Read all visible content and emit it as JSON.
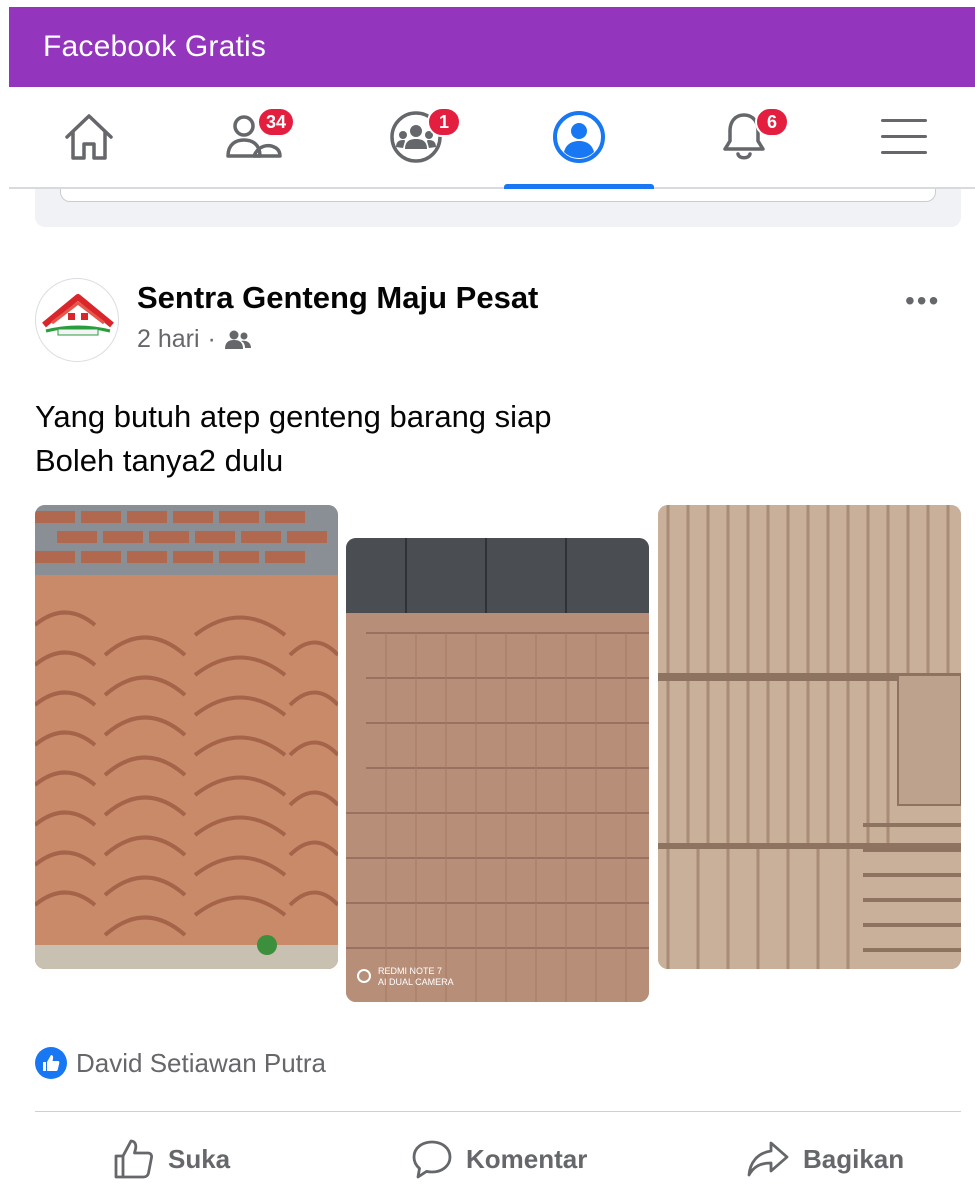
{
  "app_bar": {
    "title": "Facebook Gratis"
  },
  "nav": {
    "items": [
      {
        "name": "home",
        "icon": "home-icon",
        "badge": ""
      },
      {
        "name": "friends",
        "icon": "friends-icon",
        "badge": "34"
      },
      {
        "name": "groups",
        "icon": "groups-icon",
        "badge": "1"
      },
      {
        "name": "profile",
        "icon": "profile-icon",
        "badge": "",
        "active": true
      },
      {
        "name": "notifications",
        "icon": "bell-icon",
        "badge": "6"
      },
      {
        "name": "menu",
        "icon": "hamburger-menu-icon",
        "badge": ""
      }
    ]
  },
  "post": {
    "author": "Sentra Genteng Maju Pesat",
    "time": "2 hari",
    "separator": "·",
    "audience_icon": "friends-audience-icon",
    "more_label": "•••",
    "text_lines": [
      "Yang butuh atep genteng barang siap",
      "Boleh tanya2 dulu"
    ],
    "photos": [
      {
        "subject": "stacked ridge roof tiles",
        "watermark": ""
      },
      {
        "subject": "stacked flat roof tiles in warehouse",
        "watermark_line1": "REDMI NOTE 7",
        "watermark_line2": "AI DUAL CAMERA"
      },
      {
        "subject": "stacked clay roof tiles close-up",
        "watermark": ""
      }
    ],
    "reactions": {
      "icon": "like-reaction-icon",
      "names": "David Setiawan Putra"
    },
    "actions": {
      "like": "Suka",
      "comment": "Komentar",
      "share": "Bagikan"
    }
  },
  "colors": {
    "app_bar": "#9436bd",
    "accent": "#1877f2",
    "badge": "#e41e3f",
    "secondary_text": "#65676b"
  }
}
